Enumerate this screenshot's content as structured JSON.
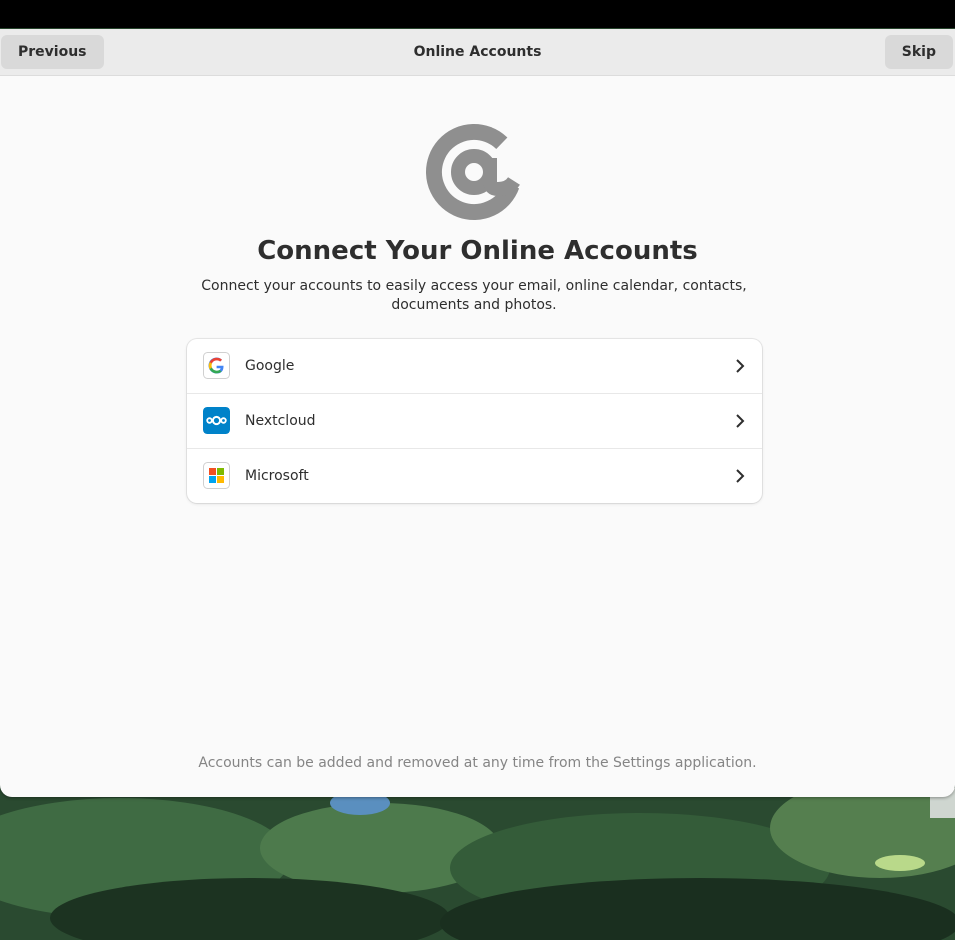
{
  "header": {
    "previous_label": "Previous",
    "title": "Online Accounts",
    "skip_label": "Skip"
  },
  "page": {
    "heading": "Connect Your Online Accounts",
    "subtitle": "Connect your accounts to easily access your email, online calendar, contacts, documents and photos.",
    "footer": "Accounts can be added and removed at any time from the Settings application."
  },
  "providers": [
    {
      "label": "Google",
      "icon": "google-logo-icon"
    },
    {
      "label": "Nextcloud",
      "icon": "nextcloud-logo-icon"
    },
    {
      "label": "Microsoft",
      "icon": "microsoft-logo-icon"
    }
  ],
  "colors": {
    "window_bg": "#fafafa",
    "headerbar_bg": "#ebebeb",
    "button_bg": "#d9d9d9",
    "text": "#2e2e2e",
    "muted_text": "#858585",
    "at_icon": "#8f8f8f",
    "nextcloud_blue": "#0082c9"
  }
}
